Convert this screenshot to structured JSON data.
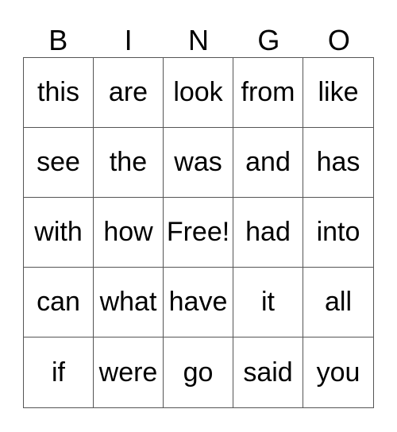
{
  "header": [
    "B",
    "I",
    "N",
    "G",
    "O"
  ],
  "rows": [
    [
      "this",
      "are",
      "look",
      "from",
      "like"
    ],
    [
      "see",
      "the",
      "was",
      "and",
      "has"
    ],
    [
      "with",
      "how",
      "Free!",
      "had",
      "into"
    ],
    [
      "can",
      "what",
      "have",
      "it",
      "all"
    ],
    [
      "if",
      "were",
      "go",
      "said",
      "you"
    ]
  ]
}
